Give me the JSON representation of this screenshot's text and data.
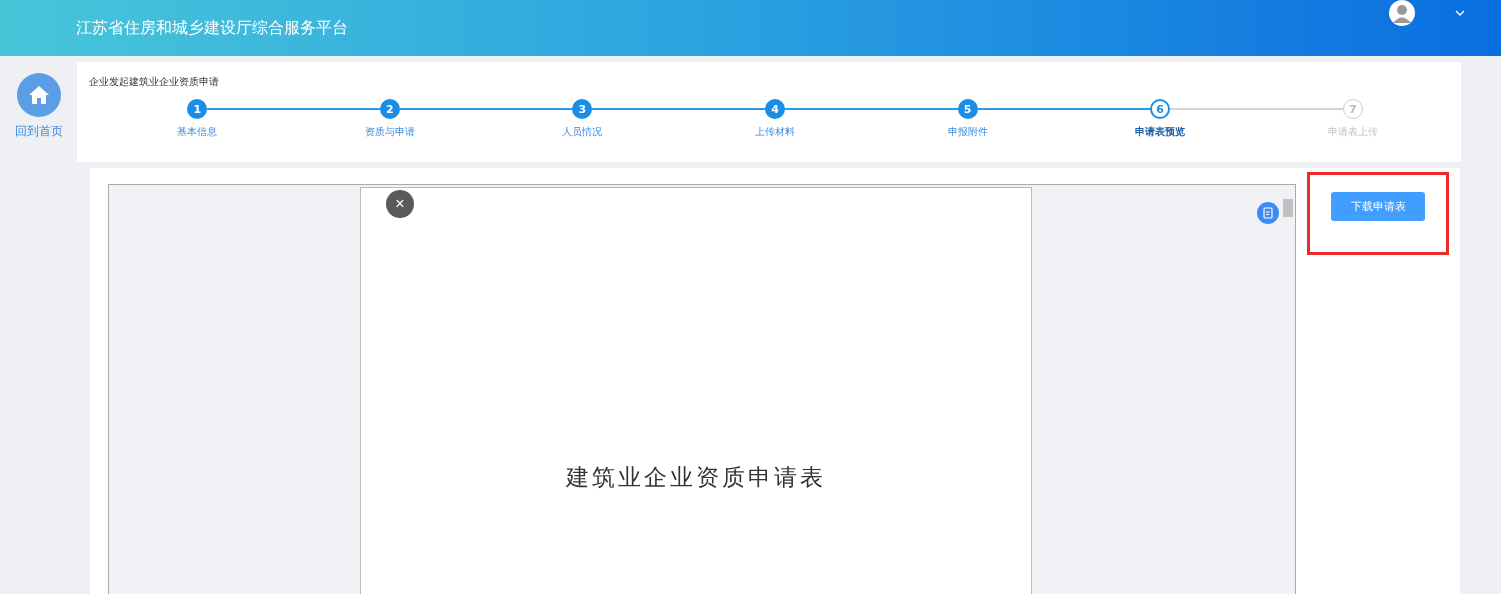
{
  "header": {
    "title": "江苏省住房和城乡建设厅综合服务平台"
  },
  "sidebar": {
    "home_label": "回到首页"
  },
  "wizard": {
    "title": "企业发起建筑业企业资质申请",
    "steps": [
      {
        "number": "1",
        "label": "基本信息",
        "done": true,
        "current": false
      },
      {
        "number": "2",
        "label": "资质与申请",
        "done": true,
        "current": false
      },
      {
        "number": "3",
        "label": "人员情况",
        "done": true,
        "current": false
      },
      {
        "number": "4",
        "label": "上传材料",
        "done": true,
        "current": false
      },
      {
        "number": "5",
        "label": "申报附件",
        "done": true,
        "current": false
      },
      {
        "number": "6",
        "label": "申请表预览",
        "done": false,
        "current": true
      },
      {
        "number": "7",
        "label": "申请表上传",
        "done": false,
        "current": false
      }
    ]
  },
  "viewer": {
    "close": "×",
    "document_title": "建筑业企业资质申请表"
  },
  "download_button": {
    "label": "下载申请表",
    "highlighted": true
  }
}
